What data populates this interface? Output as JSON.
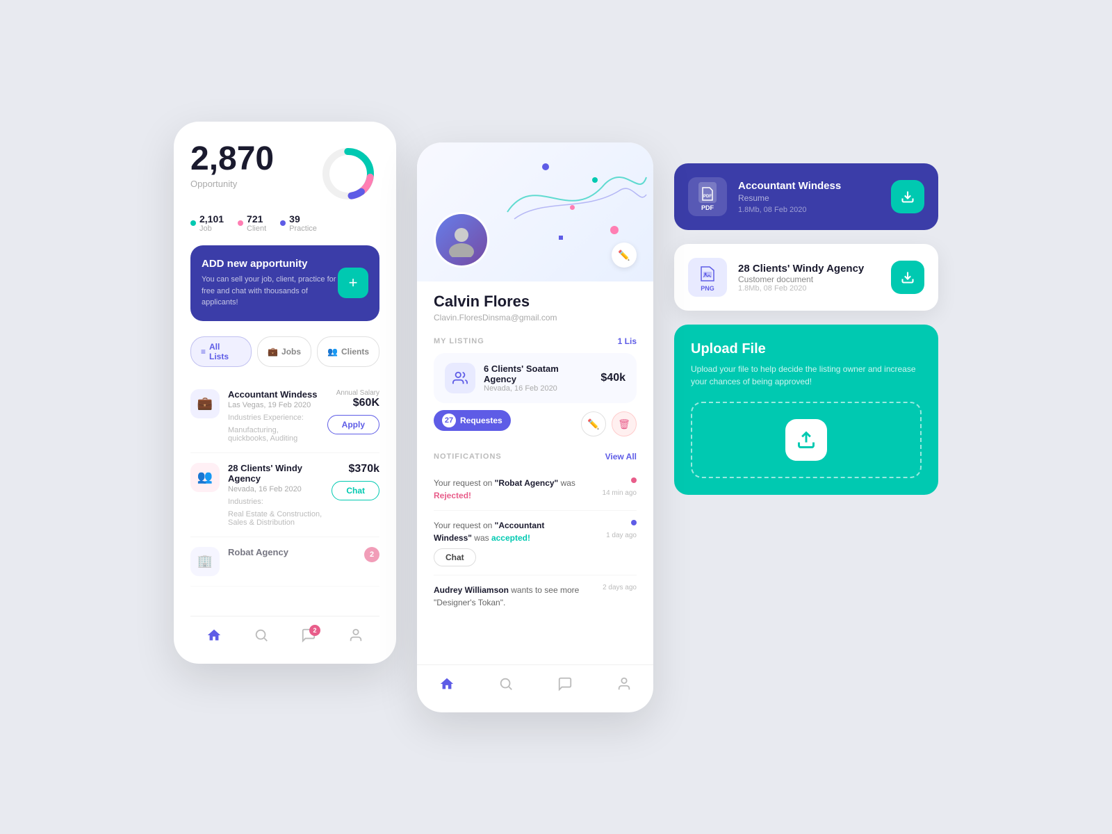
{
  "phone1": {
    "big_number": "2,870",
    "opportunity_label": "Opportunity",
    "stats": [
      {
        "value": "2,101",
        "label": "Job",
        "color": "teal"
      },
      {
        "value": "721",
        "label": "Client",
        "color": "pink"
      },
      {
        "value": "39",
        "label": "Practice",
        "color": "purple"
      }
    ],
    "banner": {
      "title": "ADD new apportunity",
      "description": "You can sell your job, client, practice for free and chat with thousands of applicants!",
      "btn_label": "+"
    },
    "filters": [
      "All Lists",
      "Jobs",
      "Clients"
    ],
    "listings": [
      {
        "title": "Accountant Windess",
        "subtitle": "Las Vegas, 19 Feb 2020",
        "industries_label": "Industries Experience:",
        "industries": "Manufacturing, quickbooks, Auditing",
        "annual_label": "Annual Salary",
        "salary": "$60K",
        "btn_label": "Apply",
        "btn_type": "outline-purple"
      },
      {
        "title": "28 Clients' Windy Agency",
        "subtitle": "Nevada, 16 Feb 2020",
        "industries_label": "Industries:",
        "industries": "Real Estate & Construction, Sales & Distribution",
        "annual_label": "",
        "salary": "$370k",
        "btn_label": "Chat",
        "btn_type": "outline-teal"
      },
      {
        "title": "Robat Agency",
        "subtitle": "",
        "industries_label": "",
        "industries": "",
        "annual_label": "",
        "salary": "",
        "btn_label": "",
        "btn_type": ""
      }
    ],
    "nav_badge": "2"
  },
  "phone2": {
    "profile_name": "Calvin Flores",
    "profile_email": "Clavin.FloresDinsma@gmail.com",
    "my_listing_label": "MY LISTING",
    "listing_count": "1 Lis",
    "listing": {
      "title": "6 Clients' Soatam Agency",
      "subtitle": "Nevada, 16 Feb 2020",
      "salary": "$40k"
    },
    "request_count": "27",
    "request_label": "Requestes",
    "notifications_label": "NOTIFICATIONS",
    "view_all_label": "View All",
    "notifications": [
      {
        "text_before": "Your request on ",
        "bold": "\"Robat Agency\"",
        "text_after": " was ",
        "status": "Rejected!",
        "status_color": "red",
        "time": "14 min ago",
        "has_chat_btn": false
      },
      {
        "text_before": "Your request on ",
        "bold": "\"Accountant Windess\"",
        "text_after": " was ",
        "status": "accepted!",
        "status_color": "green",
        "time": "1 day ago",
        "has_chat_btn": true,
        "chat_btn_label": "Chat"
      },
      {
        "text_before": "Audrey Williamson",
        "bold": " wants to see more ",
        "text_after": "\"Designer's Tokan\".",
        "status": "",
        "status_color": "",
        "time": "2 days ago",
        "has_chat_btn": false
      }
    ]
  },
  "file_card_purple": {
    "file_type": "PDF",
    "file_name": "Accountant Windess",
    "file_subtitle": "Resume",
    "file_meta": "1.8Mb, 08 Feb 2020",
    "btn_label": "↓"
  },
  "file_card_white": {
    "file_type": "PNG",
    "file_name": "28 Clients' Windy Agency",
    "file_subtitle": "Customer document",
    "file_meta": "1.8Mb, 08 Feb 2020",
    "btn_label": "↓"
  },
  "upload_card": {
    "title": "Upload File",
    "description": "Upload your file to help decide the listing owner and increase your chances of being approved!",
    "icon": "↑"
  }
}
